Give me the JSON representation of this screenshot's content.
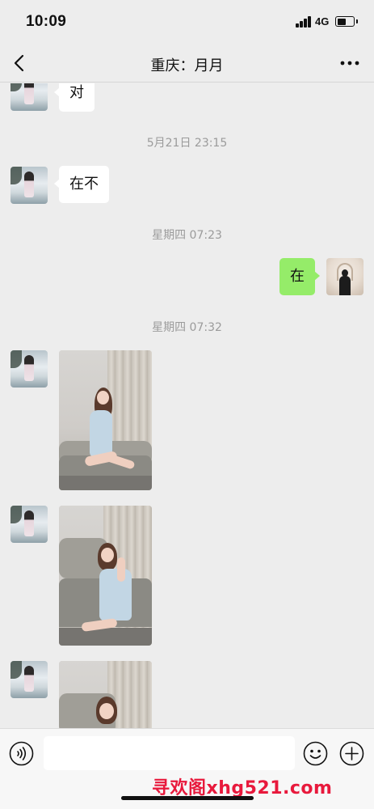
{
  "status_bar": {
    "time": "10:09",
    "network": "4G",
    "battery_level": 0.55
  },
  "nav": {
    "title": "重庆：月月",
    "back_icon": "chevron-left-icon",
    "more_icon": "more-dots-icon"
  },
  "messages": {
    "m1_text": "对",
    "ts1": "5月21日 23:15",
    "m2_text": "在不",
    "ts2": "星期四 07:23",
    "m3_text": "在",
    "ts3": "星期四 07:32"
  },
  "input_bar": {
    "voice_icon": "voice-icon",
    "emoji_icon": "emoji-icon",
    "plus_icon": "plus-icon",
    "value": ""
  },
  "watermark": "寻欢阁xhg521.com",
  "colors": {
    "background": "#ededed",
    "my_bubble": "#95ec69",
    "their_bubble": "#ffffff",
    "watermark": "#e8193c"
  }
}
